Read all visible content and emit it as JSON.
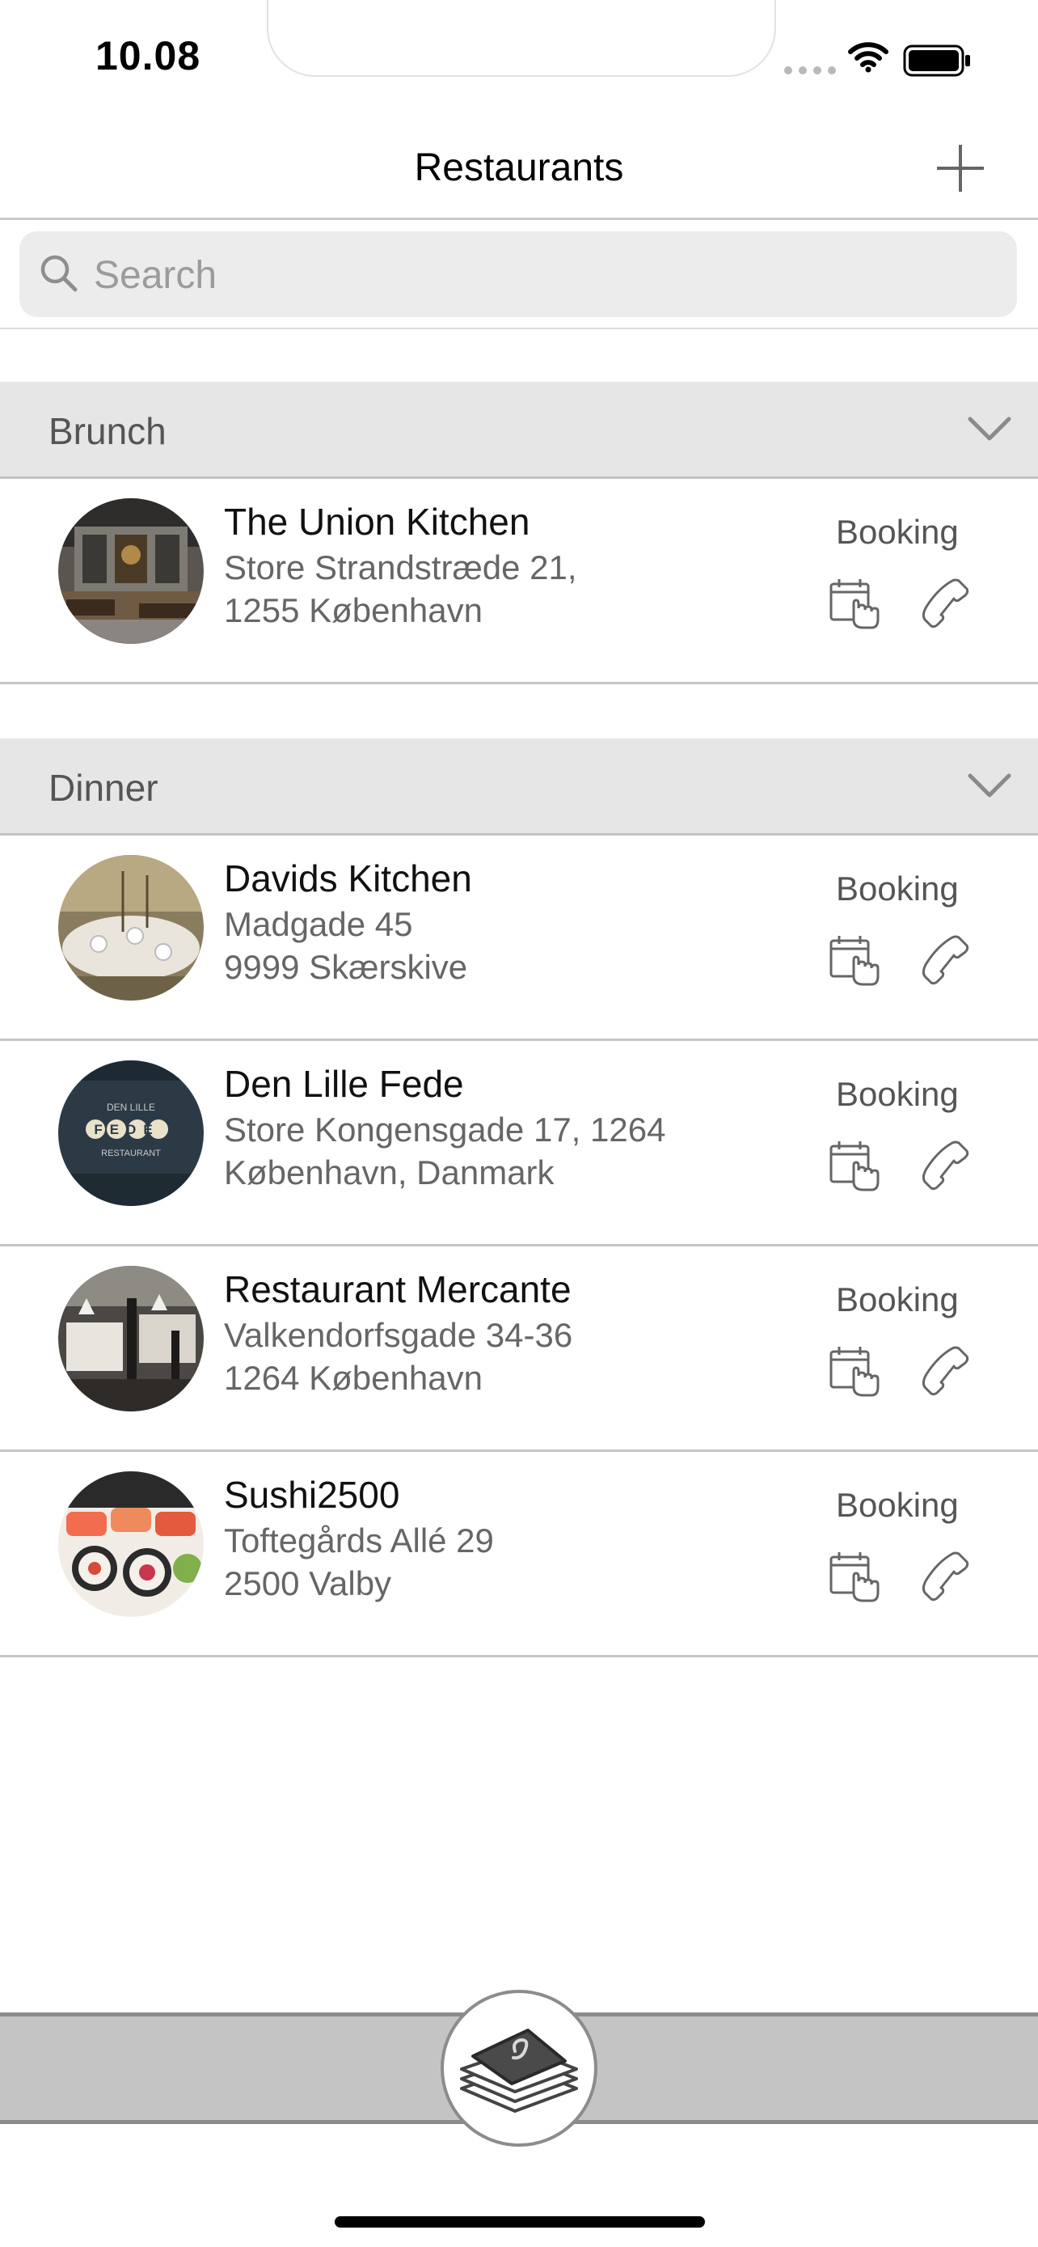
{
  "status_bar": {
    "time": "10.08"
  },
  "nav": {
    "title": "Restaurants",
    "add_icon": "plus-icon"
  },
  "search": {
    "placeholder": "Search"
  },
  "sections": [
    {
      "title": "Brunch",
      "rows": [
        {
          "name": "The Union Kitchen",
          "address_line1": "Store Strandstræde 21,",
          "address_line2": "1255 København",
          "booking_label": "Booking"
        }
      ]
    },
    {
      "title": "Dinner",
      "rows": [
        {
          "name": "Davids Kitchen",
          "address_line1": "Madgade 45",
          "address_line2": "9999 Skærskive",
          "booking_label": "Booking"
        },
        {
          "name": "Den Lille Fede",
          "address_line1": "Store Kongensgade 17, 1264",
          "address_line2": "København, Danmark",
          "booking_label": "Booking"
        },
        {
          "name": "Restaurant Mercante",
          "address_line1": "Valkendorfsgade 34-36",
          "address_line2": "1264 København",
          "booking_label": "Booking"
        },
        {
          "name": "Sushi2500",
          "address_line1": "Toftegårds Allé 29",
          "address_line2": "2500 Valby",
          "booking_label": "Booking"
        }
      ]
    }
  ],
  "logo_text": {
    "den_lille": "DEN LILLE",
    "fede": "FEDE",
    "restaurant": "RESTAURANT"
  },
  "colors": {
    "section_bg": "#e6e6e6",
    "tab_bar_bg": "#c4c4c4",
    "text_secondary": "#666666"
  }
}
